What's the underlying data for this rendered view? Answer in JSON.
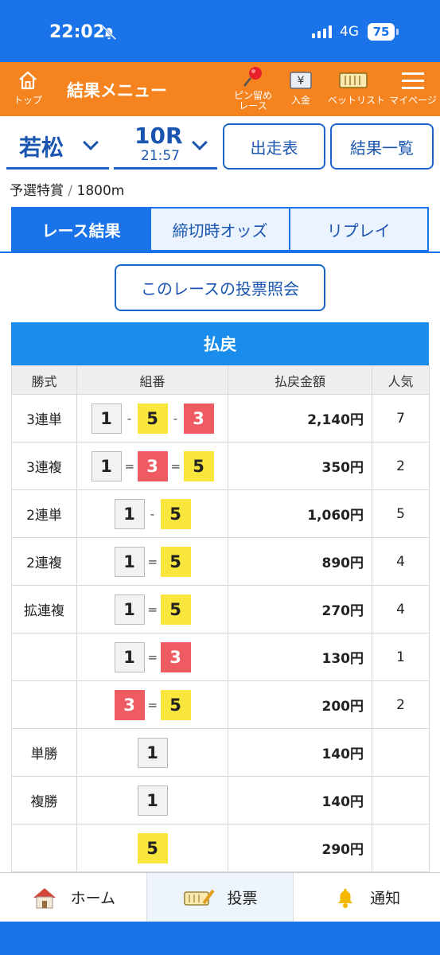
{
  "status": {
    "time": "22:02",
    "network": "4G",
    "battery": "75"
  },
  "header": {
    "top_label": "トップ",
    "title": "結果メニュー",
    "pin_label_1": "ピン留め",
    "pin_label_2": "レース",
    "deposit_label": "入金",
    "betlist_label": "ベットリスト",
    "mypage_label": "マイページ"
  },
  "race": {
    "venue": "若松",
    "number": "10R",
    "time": "21:57",
    "entry_button": "出走表",
    "results_button": "結果一覧",
    "name": "予選特賞",
    "separator": "/",
    "distance": "1800m"
  },
  "tabs": [
    "レース結果",
    "締切時オッズ",
    "リプレイ"
  ],
  "vote_inquiry_button": "このレースの投票照会",
  "payout": {
    "title": "払戻",
    "columns": [
      "勝式",
      "組番",
      "払戻金額",
      "人気"
    ],
    "rows": [
      {
        "type": "3連単",
        "combo": [
          "1",
          "-",
          "5",
          "-",
          "3"
        ],
        "amount": "2,140円",
        "popularity": "7"
      },
      {
        "type": "3連複",
        "combo": [
          "1",
          "=",
          "3",
          "=",
          "5"
        ],
        "amount": "350円",
        "popularity": "2"
      },
      {
        "type": "2連単",
        "combo": [
          "1",
          "-",
          "5"
        ],
        "amount": "1,060円",
        "popularity": "5"
      },
      {
        "type": "2連複",
        "combo": [
          "1",
          "=",
          "5"
        ],
        "amount": "890円",
        "popularity": "4"
      },
      {
        "type": "拡連複",
        "combo": [
          "1",
          "=",
          "5"
        ],
        "amount": "270円",
        "popularity": "4"
      },
      {
        "type": "",
        "combo": [
          "1",
          "=",
          "3"
        ],
        "amount": "130円",
        "popularity": "1"
      },
      {
        "type": "",
        "combo": [
          "3",
          "=",
          "5"
        ],
        "amount": "200円",
        "popularity": "2"
      },
      {
        "type": "単勝",
        "combo": [
          "1"
        ],
        "amount": "140円",
        "popularity": ""
      },
      {
        "type": "複勝",
        "combo": [
          "1"
        ],
        "amount": "140円",
        "popularity": ""
      },
      {
        "type": "",
        "combo": [
          "5"
        ],
        "amount": "290円",
        "popularity": ""
      }
    ]
  },
  "boat_colors": {
    "1": "#f2f2f2",
    "3": "#ef5b62",
    "5": "#f8e63c"
  },
  "bottom_nav": {
    "home": "ホーム",
    "vote": "投票",
    "notify": "通知"
  },
  "colors": {
    "primary": "#1a73e8",
    "header": "#f5831f"
  }
}
